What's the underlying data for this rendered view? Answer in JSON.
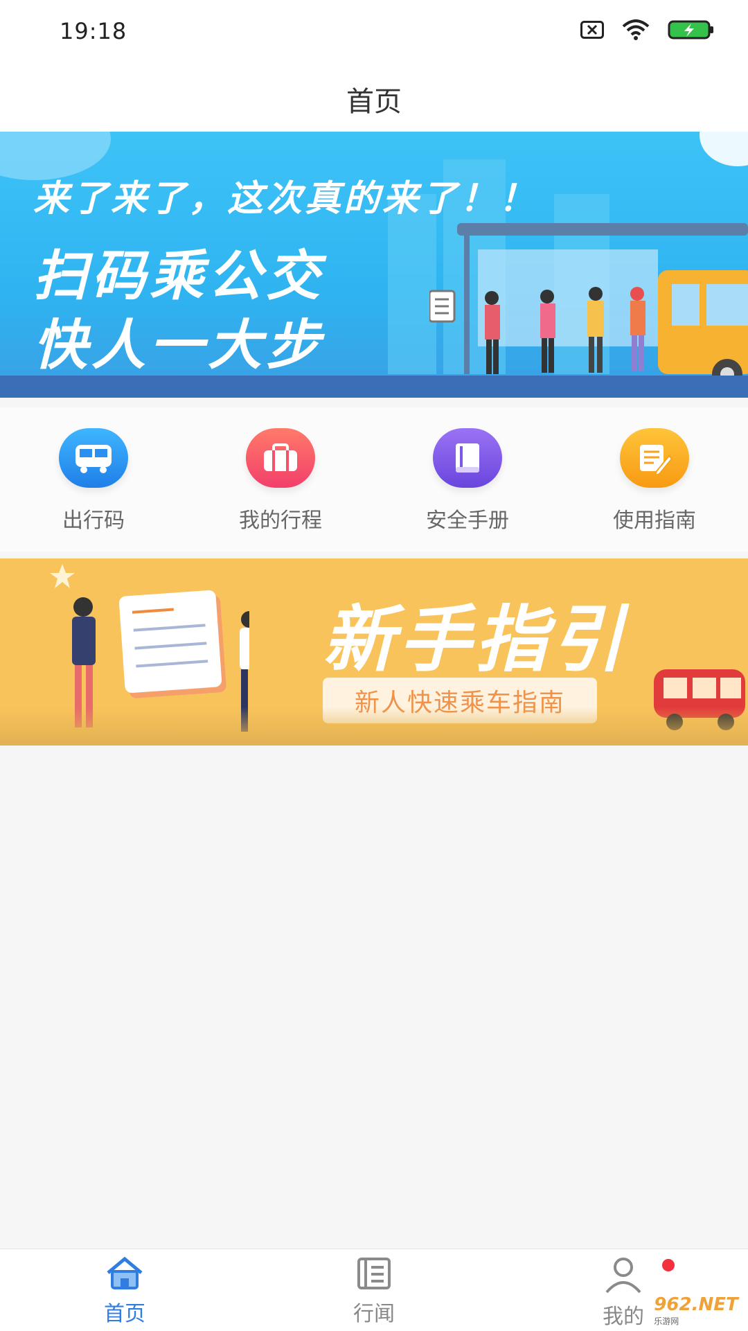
{
  "status_bar": {
    "time": "19:18",
    "icons": [
      "sim-error-icon",
      "wifi-icon",
      "battery-charging-icon"
    ]
  },
  "header": {
    "title": "首页"
  },
  "banner_top": {
    "headline": "来了来了，这次真的来了！！",
    "slogan_line1": "扫码乘公交",
    "slogan_line2": "快人一大步"
  },
  "quick_actions": [
    {
      "label": "出行码",
      "icon": "bus-icon",
      "color": "#2c8ef0"
    },
    {
      "label": "我的行程",
      "icon": "suitcase-icon",
      "color": "#f3526a"
    },
    {
      "label": "安全手册",
      "icon": "book-icon",
      "color": "#7b57e6"
    },
    {
      "label": "使用指南",
      "icon": "guide-edit-icon",
      "color": "#f7a21a"
    }
  ],
  "banner_guide": {
    "title": "新手指引",
    "subtitle": "新人快速乘车指南"
  },
  "bottom_nav": {
    "items": [
      {
        "label": "首页",
        "icon": "home-icon",
        "active": true
      },
      {
        "label": "行闻",
        "icon": "news-icon",
        "active": false
      },
      {
        "label": "我的",
        "icon": "user-icon",
        "active": false
      }
    ]
  },
  "watermark": {
    "text": "962.NET",
    "sub": "乐游网"
  },
  "colors": {
    "accent": "#2f7de1",
    "badge": "#f2303e"
  }
}
